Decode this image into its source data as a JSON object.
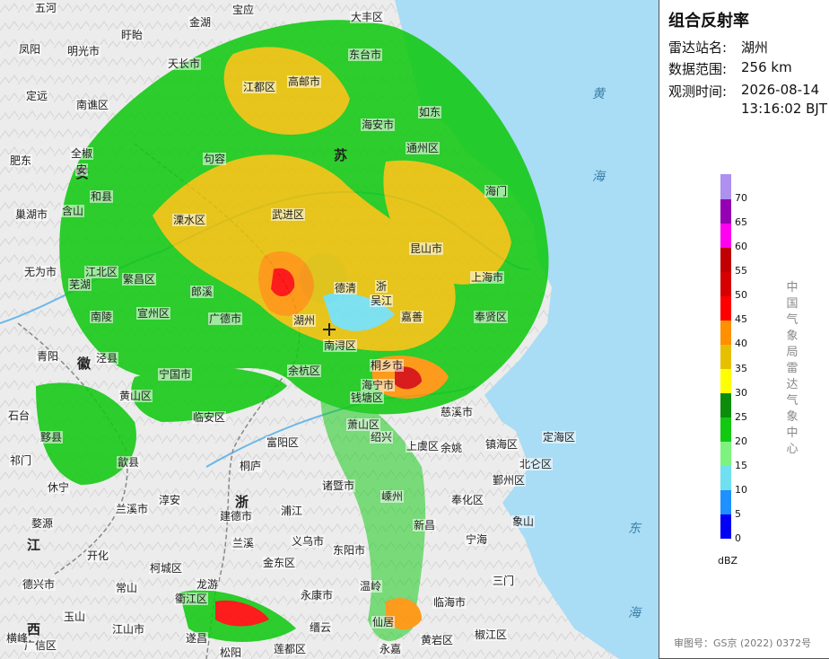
{
  "panel": {
    "title": "组合反射率",
    "station_label": "雷达站名:",
    "station_value": "湖州",
    "range_label": "数据范围:",
    "range_value": "256 km",
    "time_label": "观测时间:",
    "time_date": "2026-08-14",
    "time_clock": "13:16:02 BJT",
    "legend_unit": "dBZ",
    "legend_source": "中国气象局雷达气象中心",
    "approval": "审图号：GS京 (2022) 0372号"
  },
  "legend": [
    {
      "value": "0",
      "color": "#0000f6"
    },
    {
      "value": "5",
      "color": "#1e90ff"
    },
    {
      "value": "10",
      "color": "#6fe0f0"
    },
    {
      "value": "15",
      "color": "#7ef27e"
    },
    {
      "value": "20",
      "color": "#12c912"
    },
    {
      "value": "25",
      "color": "#0b8d0b"
    },
    {
      "value": "30",
      "color": "#ffff00"
    },
    {
      "value": "35",
      "color": "#e6c000"
    },
    {
      "value": "40",
      "color": "#ff9000"
    },
    {
      "value": "45",
      "color": "#ff0000"
    },
    {
      "value": "50",
      "color": "#d60000"
    },
    {
      "value": "55",
      "color": "#c00000"
    },
    {
      "value": "60",
      "color": "#ff00f0"
    },
    {
      "value": "65",
      "color": "#9600b4"
    },
    {
      "value": "70",
      "color": "#ad90f0"
    }
  ],
  "map": {
    "seas": [
      "黄",
      "海",
      "东",
      "海"
    ],
    "provinces": [
      "苏",
      "安",
      "浙",
      "徽",
      "江",
      "西"
    ],
    "places": [
      "五河",
      "宝应",
      "大丰区",
      "金湖",
      "凤阳",
      "明光市",
      "盱眙",
      "东台市",
      "天长市",
      "定远",
      "南谯区",
      "高邮市",
      "江都区",
      "如东",
      "肥东",
      "全椒",
      "海安市",
      "通州区",
      "安",
      "和县",
      "句容",
      "巢湖市",
      "含山",
      "溧水区",
      "武进区",
      "无为市",
      "江北区",
      "繁昌区",
      "芜湖",
      "郎溪",
      "广德市",
      "宣州区",
      "南陵",
      "泾县",
      "湖州",
      "青阳",
      "宁国市",
      "临安区",
      "余杭区",
      "钱塘区",
      "海宁市",
      "上海市",
      "嘉善",
      "奉贤区",
      "昆山市",
      "吴江",
      "慈溪市",
      "镇海区",
      "定海区",
      "北仑区",
      "鄞州区",
      "奉化区",
      "象山",
      "宁海",
      "三门",
      "临海市",
      "椒江区",
      "黄岩区",
      "温岭",
      "仙居",
      "永嘉",
      "缙云",
      "永康市",
      "东阳市",
      "义乌市",
      "诸暨市",
      "绍兴",
      "上虞区",
      "余姚",
      "嵊州",
      "新昌",
      "金东区",
      "兰溪",
      "建德市",
      "桐庐",
      "富阳区",
      "萧山区",
      "南浔区",
      "桐乡市",
      "淳安",
      "歙县",
      "黟县",
      "祁门",
      "石台",
      "休宁",
      "婺源",
      "开化",
      "常山",
      "衢江区",
      "龙游",
      "柯城区",
      "江山市",
      "遂昌",
      "松阳",
      "莲都区",
      "德兴市",
      "玉山",
      "广信区",
      "横峰",
      "浦江",
      "兰溪市",
      "海门",
      "黄山区",
      "德清",
      "浙"
    ]
  }
}
